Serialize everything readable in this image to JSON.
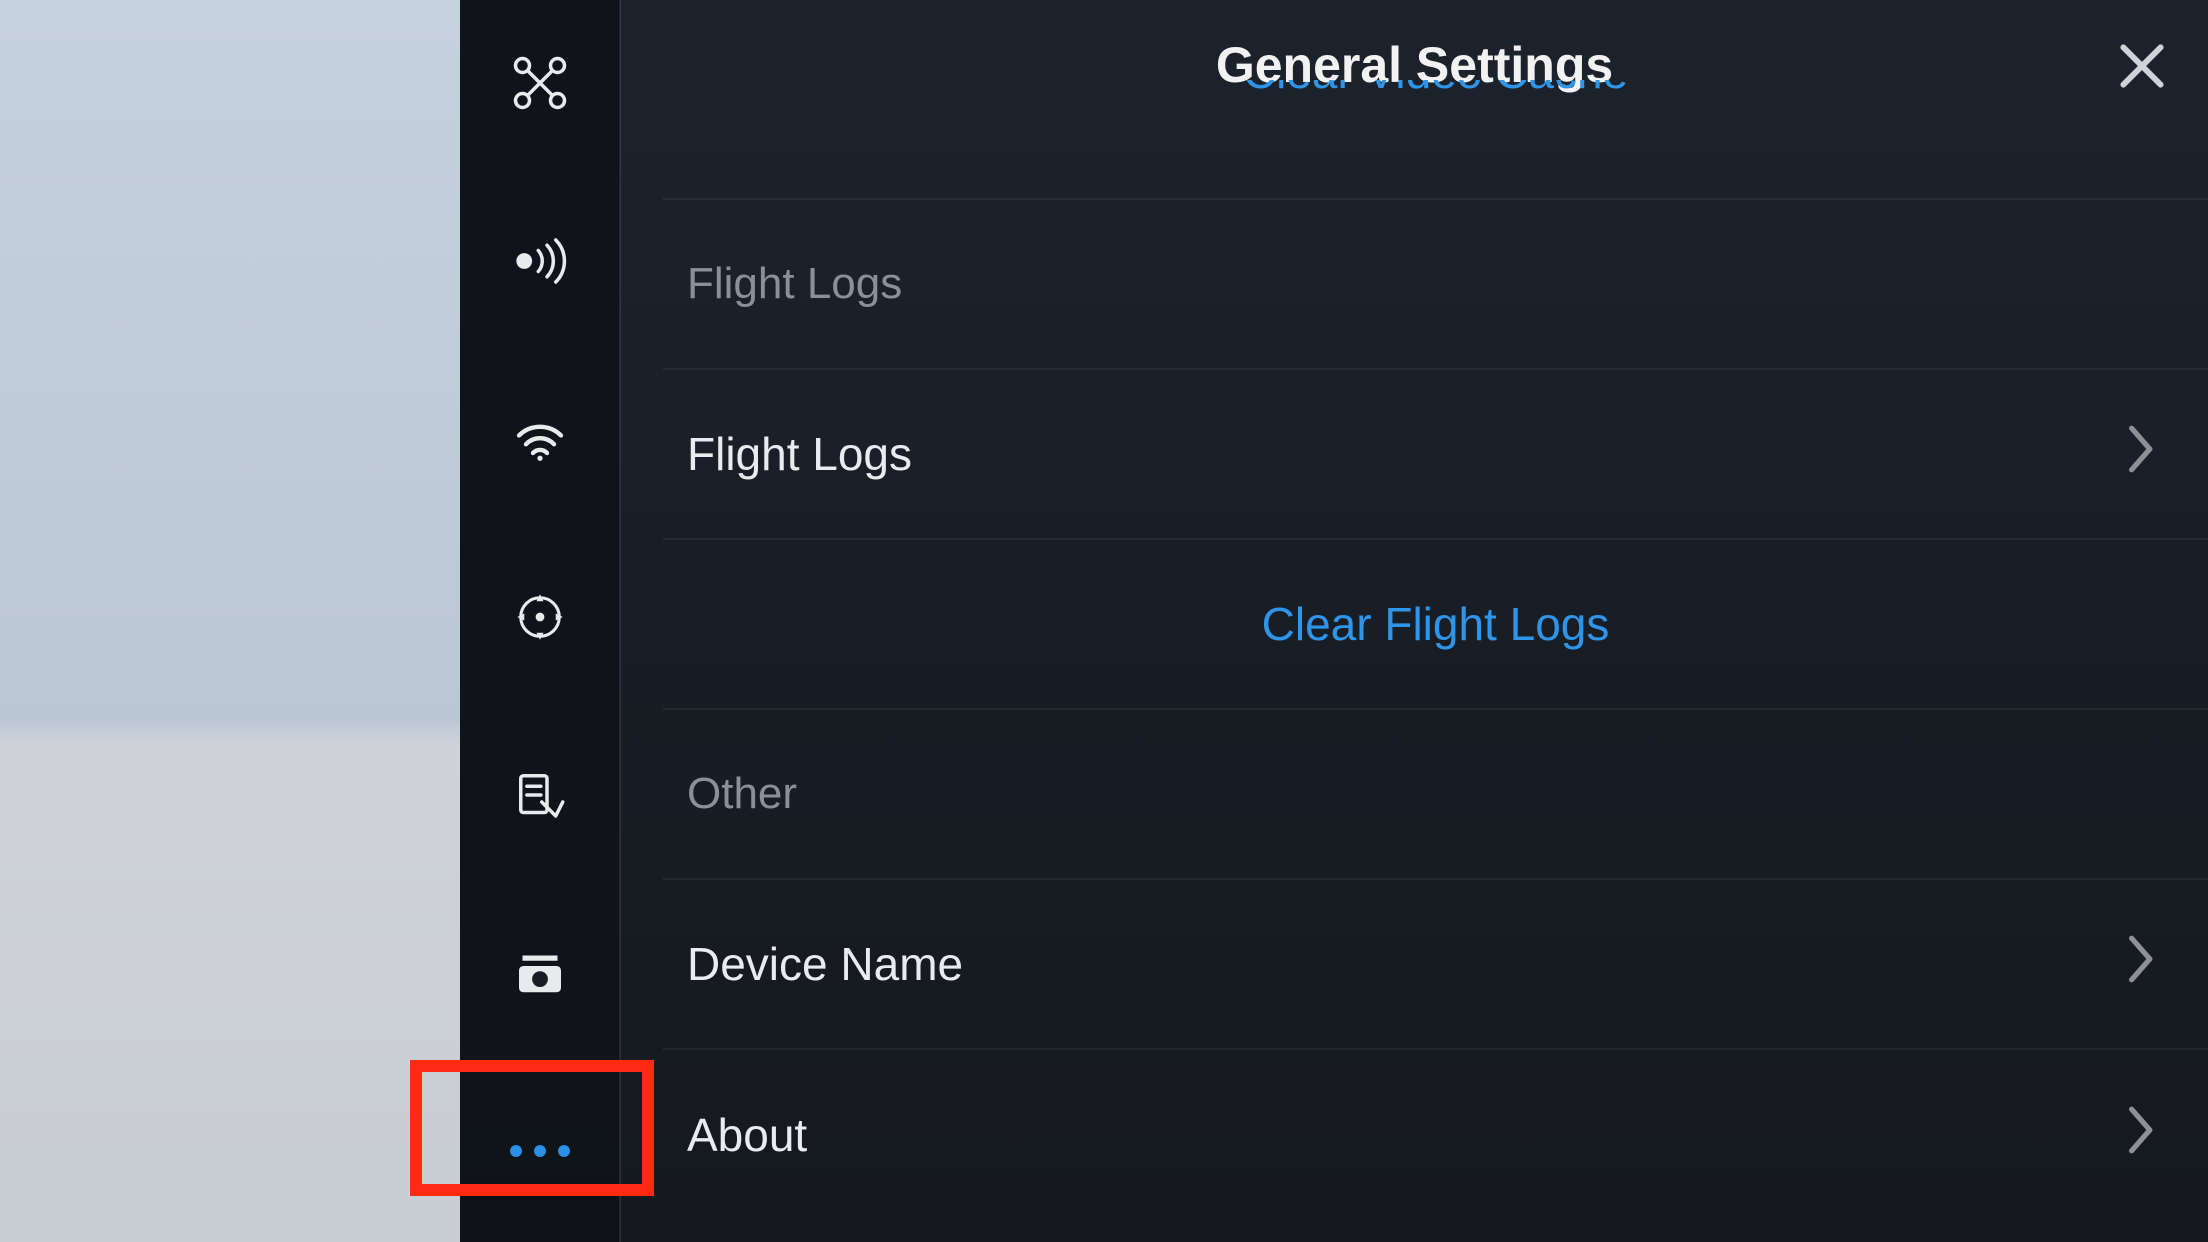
{
  "colors": {
    "accent": "#2f95e8",
    "highlight_box": "#ff2a12",
    "text_primary": "#e9ebee",
    "text_secondary": "#8a9098"
  },
  "header": {
    "title": "General Settings"
  },
  "partial_action_above": {
    "label": "Clear Video Cache"
  },
  "sections": [
    {
      "key": "flight_logs",
      "header": "Flight Logs",
      "rows": [
        {
          "type": "nav",
          "label": "Flight Logs"
        },
        {
          "type": "action",
          "label": "Clear Flight Logs"
        }
      ]
    },
    {
      "key": "other",
      "header": "Other",
      "rows": [
        {
          "type": "nav",
          "label": "Device Name"
        },
        {
          "type": "nav",
          "label": "About"
        }
      ]
    }
  ],
  "sidebar": {
    "items": [
      {
        "icon": "drone-icon"
      },
      {
        "icon": "signal-icon"
      },
      {
        "icon": "wifi-icon"
      },
      {
        "icon": "gimbal-icon"
      },
      {
        "icon": "checklist-icon"
      },
      {
        "icon": "camera-icon"
      },
      {
        "icon": "more-icon",
        "active": true
      }
    ]
  }
}
